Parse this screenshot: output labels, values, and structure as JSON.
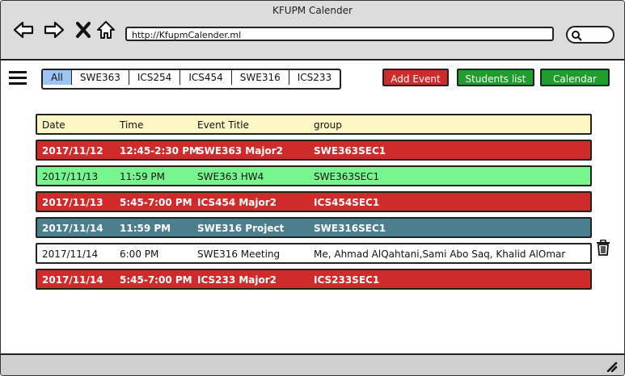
{
  "window": {
    "title": "KFUPM Calender"
  },
  "browser": {
    "url": "http://KfupmCalender.ml",
    "icons": [
      "back-arrow-icon",
      "forward-arrow-icon",
      "close-x-icon",
      "home-icon",
      "search-icon"
    ]
  },
  "filter_tabs": {
    "items": [
      {
        "label": "All",
        "active": true
      },
      {
        "label": "SWE363",
        "active": false
      },
      {
        "label": "ICS254",
        "active": false
      },
      {
        "label": "ICS454",
        "active": false
      },
      {
        "label": "SWE316",
        "active": false
      },
      {
        "label": "ICS233",
        "active": false
      }
    ]
  },
  "actions": {
    "add_event": "Add Event",
    "students_list": "Students list",
    "calendar": "Calendar",
    "colors": {
      "add_event": "#d02b2b",
      "students_list": "#1f9e2d",
      "calendar": "#1f9e2d"
    }
  },
  "table": {
    "headers": {
      "date": "Date",
      "time": "Time",
      "title": "Event Title",
      "group": "group"
    },
    "rows": [
      {
        "date": "2017/11/12",
        "time": "12:45-2:30 PM",
        "title": "SWE363 Major2",
        "group": "SWE363SEC1",
        "color": "red"
      },
      {
        "date": "2017/11/13",
        "time": "11:59 PM",
        "title": "SWE363 HW4",
        "group": "SWE363SEC1",
        "color": "green"
      },
      {
        "date": "2017/11/13",
        "time": "5:45-7:00 PM",
        "title": "ICS454 Major2",
        "group": "ICS454SEC1",
        "color": "red"
      },
      {
        "date": "2017/11/14",
        "time": "11:59 PM",
        "title": "SWE316 Project",
        "group": "SWE316SEC1",
        "color": "teal"
      },
      {
        "date": "2017/11/14",
        "time": "6:00 PM",
        "title": "SWE316 Meeting",
        "group": "Me, Ahmad AlQahtani,Sami Abo Saq, Khalid AlOmar",
        "color": "white"
      },
      {
        "date": "2017/11/14",
        "time": "5:45-7:00 PM",
        "title": "ICS233 Major2",
        "group": "ICS233SEC1",
        "color": "red"
      }
    ]
  }
}
